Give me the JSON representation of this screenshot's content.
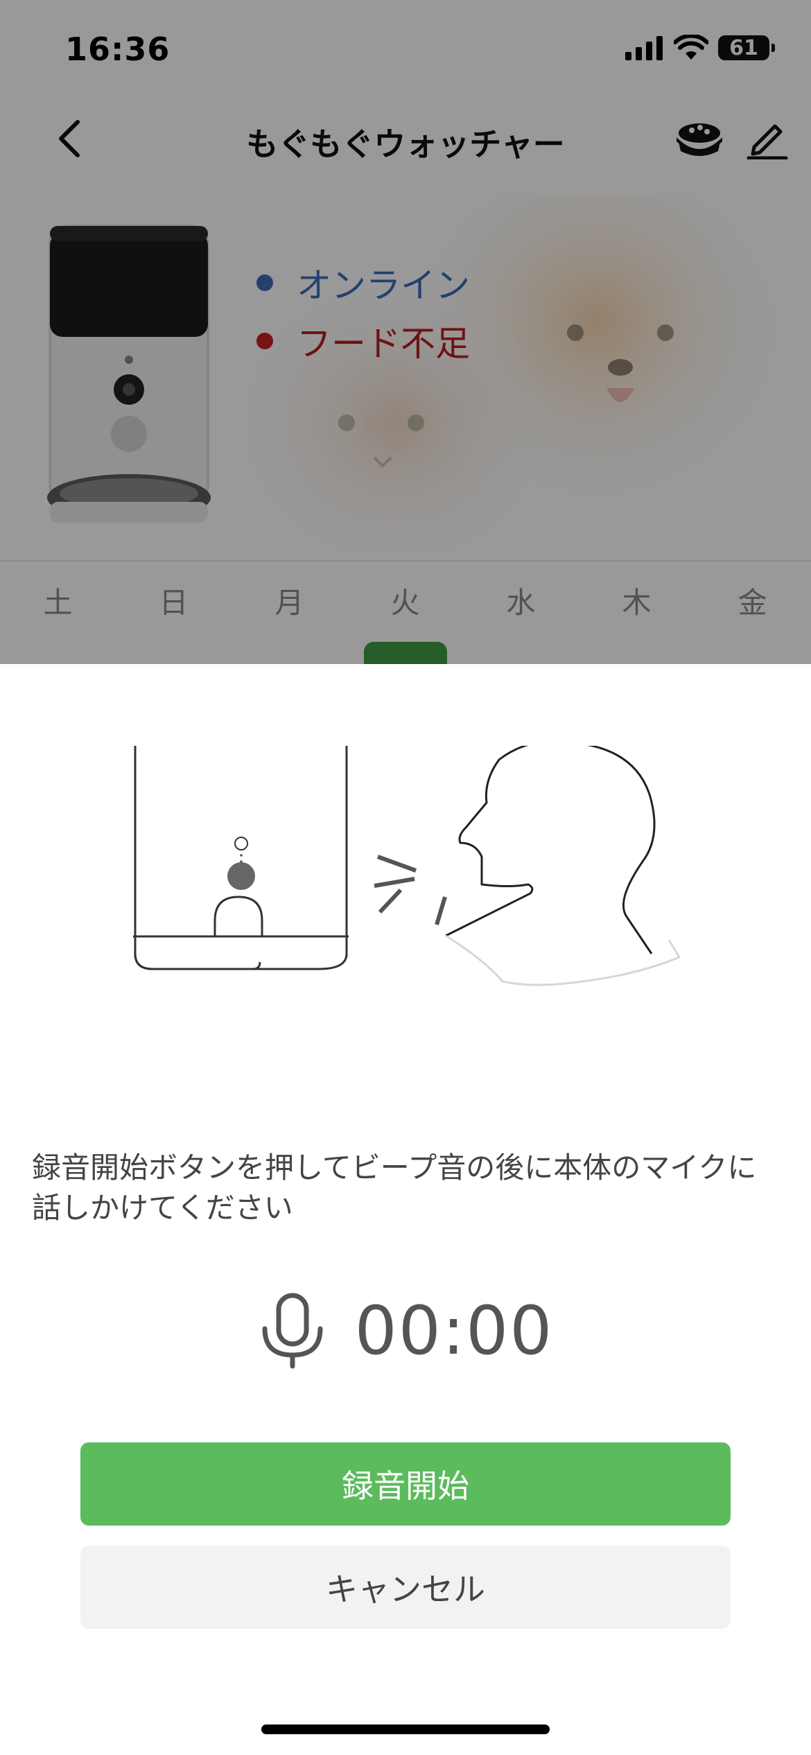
{
  "status_bar": {
    "time": "16:36",
    "battery": "61"
  },
  "nav": {
    "title": "もぐもぐウォッチャー"
  },
  "device": {
    "status_online": "オンライン",
    "status_food": "フード不足"
  },
  "week": {
    "days": [
      "土",
      "日",
      "月",
      "火",
      "水",
      "木",
      "金"
    ],
    "selected_index": 3
  },
  "recording_sheet": {
    "instruction": "録音開始ボタンを押してビープ音の後に本体のマイクに話しかけてください",
    "timer": "00:00",
    "record_button": "録音開始",
    "cancel_button": "キャンセル"
  },
  "colors": {
    "accent_green": "#5cbb5c",
    "online_blue": "#3d6db8",
    "warning_red": "#c62020"
  }
}
